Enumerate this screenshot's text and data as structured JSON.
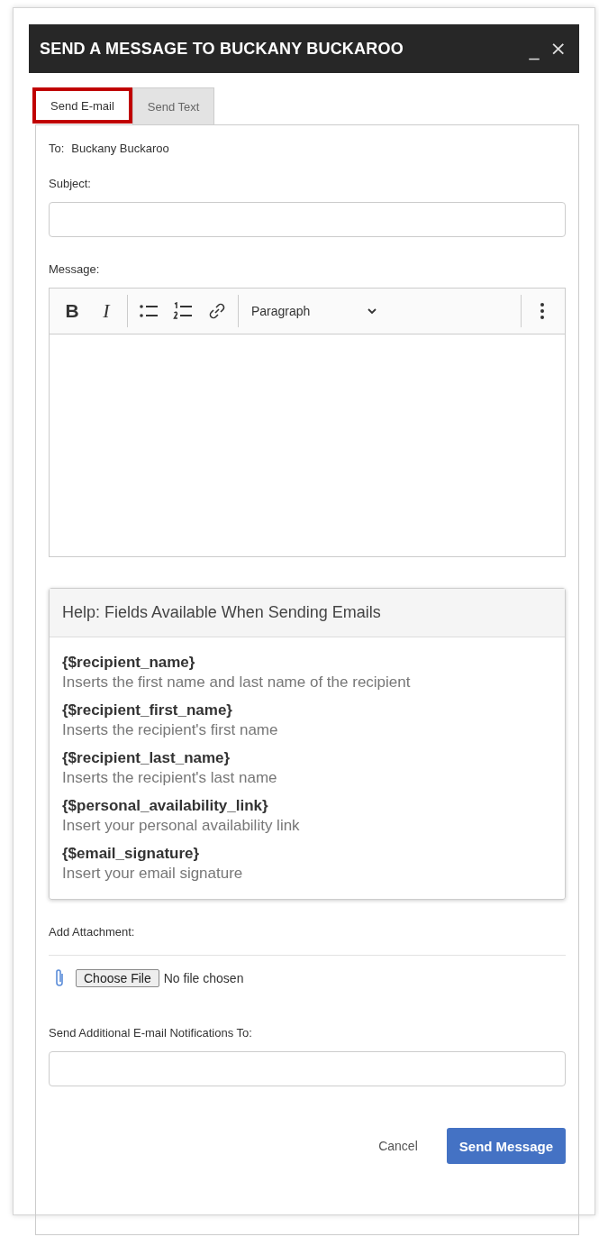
{
  "window": {
    "title": "SEND A MESSAGE TO BUCKANY BUCKAROO",
    "controls": [
      "_",
      "×"
    ]
  },
  "tabs": [
    {
      "label": "Send E-mail",
      "selected": true
    },
    {
      "label": "Send Text",
      "selected": false
    }
  ],
  "to": {
    "label": "To:",
    "value": "Buckany Buckaroo"
  },
  "subject": {
    "label": "Subject:"
  },
  "message": {
    "label": "Message:",
    "toolbar": {
      "bold": "B",
      "italic": "I",
      "format": "Paragraph"
    }
  },
  "help": {
    "title": "Help: Fields Available When Sending Emails",
    "fields": [
      {
        "name": "{$recipient_name}",
        "description": "Inserts the first name and last name of the recipient"
      },
      {
        "name": "{$recipient_first_name}",
        "description": "Inserts the recipient's first name"
      },
      {
        "name": "{$recipient_last_name}",
        "description": "Inserts the recipient's last name"
      },
      {
        "name": "{$personal_availability_link}",
        "description": "Insert your personal availability link"
      },
      {
        "name": "{$email_signature}",
        "description": "Insert your email signature"
      }
    ]
  },
  "attachment": {
    "label": "Add Attachment:",
    "button": "Choose File",
    "status": "No file chosen"
  },
  "notifications": {
    "label": "Send Additional E-mail Notifications To:"
  },
  "buttons": {
    "cancel": "Cancel",
    "submit": "Send Message"
  }
}
